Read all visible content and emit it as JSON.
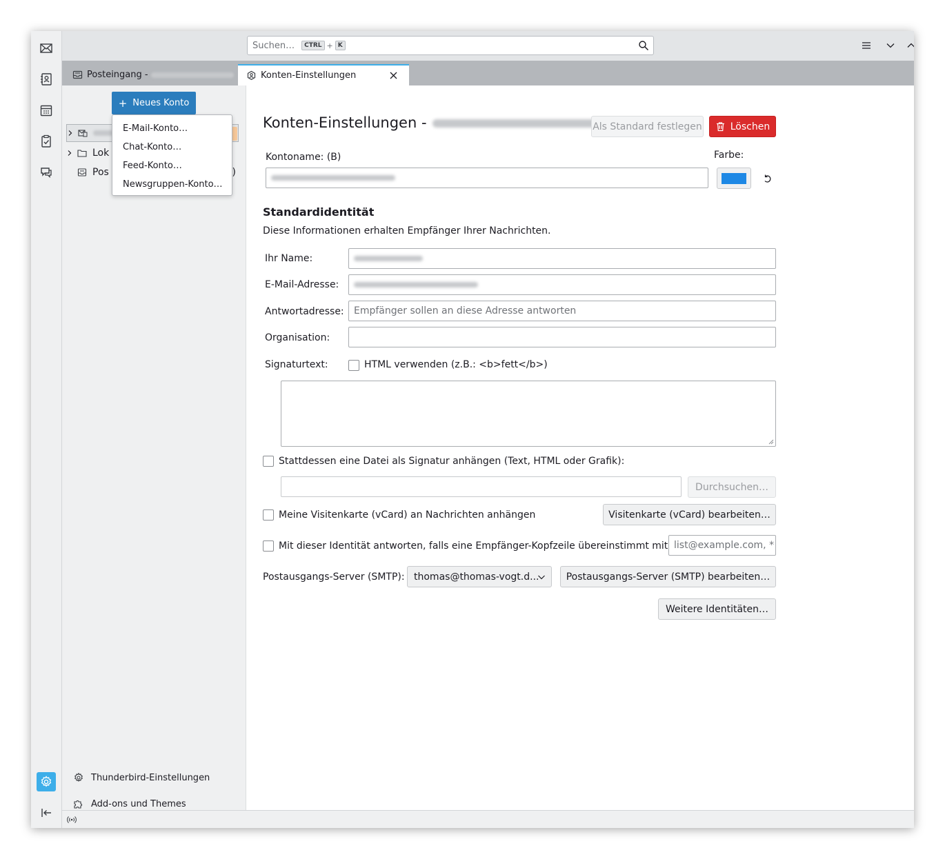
{
  "search": {
    "placeholder": "Suchen…",
    "shortcut_mod": "CTRL",
    "shortcut_plus": "+",
    "shortcut_key": "K"
  },
  "tabs": [
    {
      "label": "Posteingang -",
      "icon": "inbox-icon"
    },
    {
      "label": "Konten-Einstellungen",
      "icon": "account-settings-icon"
    }
  ],
  "folder_pane": {
    "new_account_label": "Neues Konto",
    "rows": [
      {
        "label": "Lok"
      },
      {
        "label": "Pos"
      }
    ],
    "row_suffix": ")",
    "menu": [
      "E-Mail-Konto…",
      "Chat-Konto…",
      "Feed-Konto…",
      "Newsgruppen-Konto…"
    ],
    "links": [
      "Thunderbird-Einstellungen",
      "Add-ons und Themes"
    ]
  },
  "settings": {
    "title": "Konten-Einstellungen -",
    "set_default_label": "Als Standard festlegen",
    "delete_label": "Löschen",
    "account_name_label": "Kontoname: (B)",
    "color_label": "Farbe:",
    "color_value": "#1e88e5",
    "identity_heading": "Standardidentität",
    "identity_desc": "Diese Informationen erhalten Empfänger Ihrer Nachrichten.",
    "name_label": "Ihr Name:",
    "email_label": "E-Mail-Adresse:",
    "reply_label": "Antwortadresse:",
    "reply_placeholder": "Empfänger sollen an diese Adresse antworten",
    "org_label": "Organisation:",
    "sig_label": "Signaturtext:",
    "html_label": "HTML verwenden (z.B.: <b>fett</b>)",
    "sig_file_label": "Stattdessen eine Datei als Signatur anhängen (Text, HTML oder Grafik):",
    "browse_label": "Durchsuchen…",
    "vcard_label": "Meine Visitenkarte (vCard) an Nachrichten anhängen",
    "vcard_edit_label": "Visitenkarte (vCard) bearbeiten…",
    "reply_match_label": "Mit dieser Identität antworten, falls eine Empfänger-Kopfzeile übereinstimmt mit:",
    "reply_match_placeholder": "list@example.com, *",
    "smtp_label": "Postausgangs-Server (SMTP):",
    "smtp_value": "thomas@thomas-vogt.d...",
    "smtp_edit_label": "Postausgangs-Server (SMTP) bearbeiten…",
    "more_identities_label": "Weitere Identitäten…"
  }
}
